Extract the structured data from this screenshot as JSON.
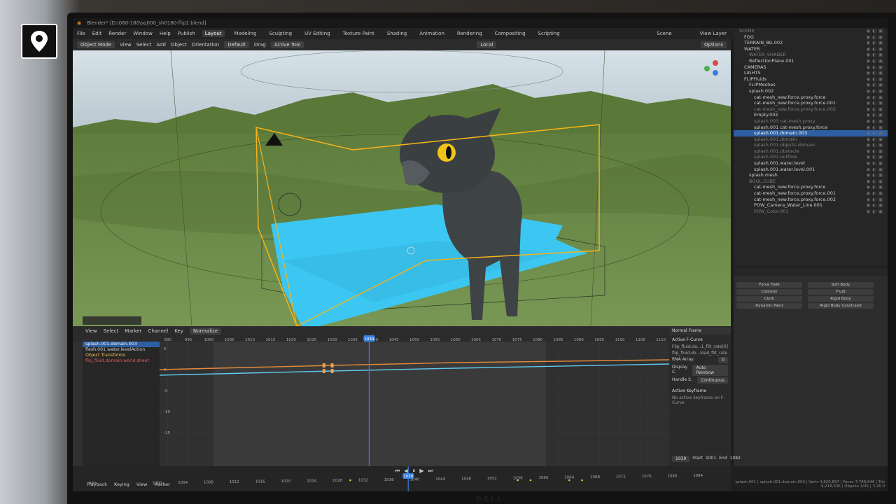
{
  "app": {
    "title": "Blender* [D:\\060-180\\sq000_sh0180-flip2.blend]",
    "menu": [
      "File",
      "Edit",
      "Render",
      "Window",
      "Help",
      "Publish"
    ],
    "workspaces": [
      "Layout",
      "Modeling",
      "Sculpting",
      "UV Editing",
      "Texture Paint",
      "Shading",
      "Animation",
      "Rendering",
      "Compositing",
      "Scripting"
    ],
    "active_workspace": "Layout",
    "scene": "Scene",
    "view_layer": "View Layer"
  },
  "viewport_header": {
    "mode": "Object Mode",
    "menu": [
      "View",
      "Select",
      "Add",
      "Object"
    ],
    "orientation_label": "Orientation",
    "orientation_value": "Default",
    "drag_label": "Drag",
    "drag_value": "Active Tool",
    "transform_space": "Local",
    "options": "Options"
  },
  "outliner": {
    "rows": [
      {
        "label": "SCENE",
        "style": "dim"
      },
      {
        "label": "FOG",
        "style": ""
      },
      {
        "label": "TERRAIN_BG.002",
        "style": ""
      },
      {
        "label": "WATER",
        "style": ""
      },
      {
        "label": "WATER_SHADER",
        "style": "dim"
      },
      {
        "label": "ReflectionPlane.001",
        "style": ""
      },
      {
        "label": "CAMERAS",
        "style": ""
      },
      {
        "label": "LIGHTS",
        "style": ""
      },
      {
        "label": "FLIPFluids",
        "style": ""
      },
      {
        "label": "FLIPMeshes",
        "style": ""
      },
      {
        "label": "splash.002",
        "style": ""
      },
      {
        "label": "cat-mesh_new.force.proxy.force",
        "style": ""
      },
      {
        "label": "cat-mesh_new.force.proxy.force.001",
        "style": ""
      },
      {
        "label": "cat-mesh_new.force.proxy.force.002",
        "style": "dim"
      },
      {
        "label": "Empty.002",
        "style": ""
      },
      {
        "label": "splash.003 cat-mesh.proxy",
        "style": "dim"
      },
      {
        "label": "splash.001 cat-mesh.proxy.force",
        "style": ""
      },
      {
        "label": "splash.001.domain.003",
        "style": "sel"
      },
      {
        "label": "splash.001.domain",
        "style": "dim"
      },
      {
        "label": "splash.001.objects.domain",
        "style": "dim"
      },
      {
        "label": "splash.001.obstacle",
        "style": "dim"
      },
      {
        "label": "splash.001.outflow",
        "style": "dim"
      },
      {
        "label": "splash.001.water.level",
        "style": ""
      },
      {
        "label": "splash.001.water.level.001",
        "style": ""
      },
      {
        "label": "splash.mesh",
        "style": ""
      },
      {
        "label": "BOOL.CUBE",
        "style": "dim"
      },
      {
        "label": "cat-mesh_new.force.proxy.force",
        "style": ""
      },
      {
        "label": "cat-mesh_new.force.proxy.force.001",
        "style": ""
      },
      {
        "label": "cat-mesh_new.force.proxy.force.002",
        "style": ""
      },
      {
        "label": "POW_Camera_Water_Line.001",
        "style": ""
      },
      {
        "label": "POW_Color.001",
        "style": "dim"
      }
    ]
  },
  "physics": {
    "buttons": [
      "Force Field",
      "Soft Body",
      "Collision",
      "Fluid",
      "Cloth",
      "Rigid Body",
      "Dynamic Paint",
      "Rigid Body Constraint"
    ]
  },
  "graph_editor": {
    "header_menu": [
      "View",
      "Select",
      "Marker",
      "Channel",
      "Key"
    ],
    "mode": "Normalize",
    "frame_ticks": [
      990,
      995,
      1000,
      1005,
      1010,
      1015,
      1020,
      1025,
      1030,
      1035,
      1040,
      1045,
      1050,
      1055,
      1060,
      1065,
      1070,
      1075,
      1080,
      1085,
      1090,
      1095,
      1100,
      1105,
      1110
    ],
    "current_frame": 1039,
    "value_ticks": [
      "5",
      "0",
      "-5",
      "-10",
      "-15"
    ],
    "channels": [
      {
        "label": "splash.001.domain.003",
        "color": "#ffffff",
        "bg": "#2f5fa3"
      },
      {
        "label": "flesh.001.water.levelAction",
        "color": "#cfcfcf",
        "bg": ""
      },
      {
        "label": "Object Transforms",
        "color": "#f2c14e",
        "bg": ""
      },
      {
        "label": "flip_fluid.domain.world.sheet",
        "color": "#e05a5a",
        "bg": ""
      }
    ],
    "npanel": {
      "header": "Normal Frame",
      "section_fcurve": "Active F-Curve",
      "rows": [
        "Flip_fluid.do...1_flit_rate[0]",
        "flip_fluid.do...load_flit_rate"
      ],
      "rna_array_label": "RNA Array",
      "rna_array_value": "0",
      "display_label": "Display C.",
      "display_value": "Auto Rainbow",
      "handle_label": "Handle S.",
      "handle_value": "Continuous",
      "section_keyframe": "Active Keyframe",
      "no_keyframe": "No active keyframe on F-Curve"
    },
    "start_label": "Start",
    "start_value": "1001",
    "end_label": "End",
    "end_value": "1082",
    "frame_box": "1039"
  },
  "timeline": {
    "menu": [
      "Playback",
      "Keying",
      "View",
      "Marker"
    ],
    "ticks": [
      990,
      1000,
      1004,
      1008,
      1012,
      1016,
      1020,
      1024,
      1028,
      1032,
      1036,
      1040,
      1044,
      1048,
      1052,
      1056,
      1060,
      1064,
      1068,
      1072,
      1076,
      1080,
      1084
    ],
    "current_frame": 1039
  },
  "status": {
    "text": "splash.001 | splash.001.domain.003 | Verts 4,820,897 | Faces 7,788,646 | Tris 9,218,336 | Objects 1/45 | 3.26.0"
  },
  "colors": {
    "selection": "#2f5fa3",
    "playhead": "#3a7fe0",
    "water": "#3cc7f2",
    "bbox": "#f5b31a",
    "terrain": "#6f8f4a",
    "curve_orange": "#e48a3a",
    "curve_blue": "#5fc9ee"
  },
  "icons": [
    "location-pin-icon",
    "blender-logo-icon",
    "navigation-gizmo-icon"
  ],
  "monitor_brand": "DELL"
}
